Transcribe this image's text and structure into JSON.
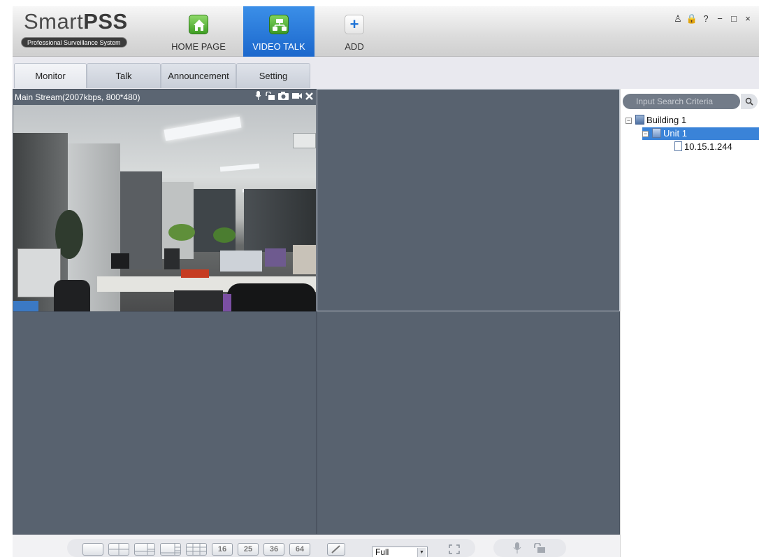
{
  "app": {
    "logo_main_light": "Smart",
    "logo_main_bold": "PSS",
    "logo_sub": "Professional Surveillance System"
  },
  "nav": {
    "home_label": "HOME PAGE",
    "video_talk_label": "VIDEO TALK",
    "add_label": "ADD"
  },
  "window_controls": {
    "user": "♙",
    "lock": "🔒",
    "help": "?",
    "minimize": "−",
    "maximize": "□",
    "close": "×"
  },
  "tabs": [
    {
      "label": "Monitor",
      "active": true
    },
    {
      "label": "Talk",
      "active": false
    },
    {
      "label": "Announcement",
      "active": false
    },
    {
      "label": "Setting",
      "active": false
    }
  ],
  "stream": {
    "info": "Main Stream(2007kbps, 800*480)",
    "icons": [
      "microphone-icon",
      "unlock-icon",
      "snapshot-icon",
      "record-icon",
      "close-icon"
    ]
  },
  "sidebar": {
    "search_placeholder": "Input Search Criteria",
    "tree": [
      {
        "label": "Building 1",
        "expanded": true
      },
      {
        "label": "Unit 1",
        "expanded": true,
        "selected": true
      },
      {
        "label": "10.15.1.244"
      }
    ]
  },
  "toolbar": {
    "layouts": [
      "1",
      "4",
      "6",
      "8",
      "9",
      "16",
      "25",
      "36",
      "64"
    ],
    "stream_mode": "Full",
    "icons": [
      "edit-layout-icon",
      "fullscreen-icon",
      "microphone-icon",
      "unlock-icon"
    ]
  },
  "colors": {
    "video_bg": "#58626f",
    "accent": "#1b67cc",
    "selection": "#3a83d8"
  }
}
